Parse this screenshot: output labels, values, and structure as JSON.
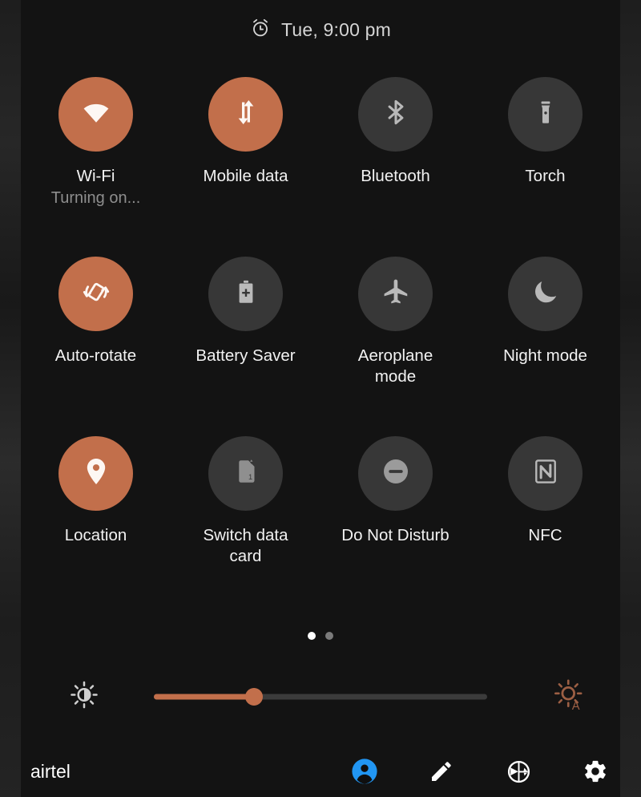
{
  "header": {
    "alarm_icon": "alarm-clock-icon",
    "datetime": "Tue, 9:00 pm"
  },
  "colors": {
    "active_tile": "#c26f4b",
    "inactive_tile": "#373737",
    "panel_background": "#131313",
    "avatar_blue": "#2196f3",
    "label_text": "#f2f2f2",
    "sublabel_text": "#8e8e8e"
  },
  "tiles": [
    {
      "id": "wifi",
      "label": "Wi-Fi",
      "sublabel": "Turning on...",
      "state": "on",
      "icon": "wifi-icon"
    },
    {
      "id": "mobile-data",
      "label": "Mobile data",
      "sublabel": "",
      "state": "on",
      "icon": "mobile-data-icon"
    },
    {
      "id": "bluetooth",
      "label": "Bluetooth",
      "sublabel": "",
      "state": "off",
      "icon": "bluetooth-icon"
    },
    {
      "id": "torch",
      "label": "Torch",
      "sublabel": "",
      "state": "off",
      "icon": "flashlight-icon"
    },
    {
      "id": "auto-rotate",
      "label": "Auto-rotate",
      "sublabel": "",
      "state": "on",
      "icon": "screen-rotation-icon"
    },
    {
      "id": "battery-saver",
      "label": "Battery Saver",
      "sublabel": "",
      "state": "off",
      "icon": "battery-plus-icon"
    },
    {
      "id": "aeroplane-mode",
      "label": "Aeroplane mode",
      "sublabel": "",
      "state": "off",
      "icon": "airplane-icon"
    },
    {
      "id": "night-mode",
      "label": "Night mode",
      "sublabel": "",
      "state": "off",
      "icon": "moon-icon"
    },
    {
      "id": "location",
      "label": "Location",
      "sublabel": "",
      "state": "on",
      "icon": "location-pin-icon"
    },
    {
      "id": "switch-data-card",
      "label": "Switch data card",
      "sublabel": "",
      "state": "off",
      "icon": "sim-card-1-icon"
    },
    {
      "id": "do-not-disturb",
      "label": "Do Not Disturb",
      "sublabel": "",
      "state": "off",
      "icon": "do-not-disturb-icon"
    },
    {
      "id": "nfc",
      "label": "NFC",
      "sublabel": "",
      "state": "off",
      "icon": "nfc-icon"
    }
  ],
  "pager": {
    "total_pages": 2,
    "current_page": 1
  },
  "brightness": {
    "left_icon": "brightness-medium-icon",
    "right_icon": "brightness-auto-icon",
    "value_percent": 30
  },
  "footer": {
    "carrier": "airtel",
    "actions": [
      {
        "id": "user",
        "icon": "user-avatar-icon"
      },
      {
        "id": "edit",
        "icon": "pencil-edit-icon"
      },
      {
        "id": "power",
        "icon": "power-circle-icon"
      },
      {
        "id": "settings",
        "icon": "gear-settings-icon"
      }
    ]
  }
}
